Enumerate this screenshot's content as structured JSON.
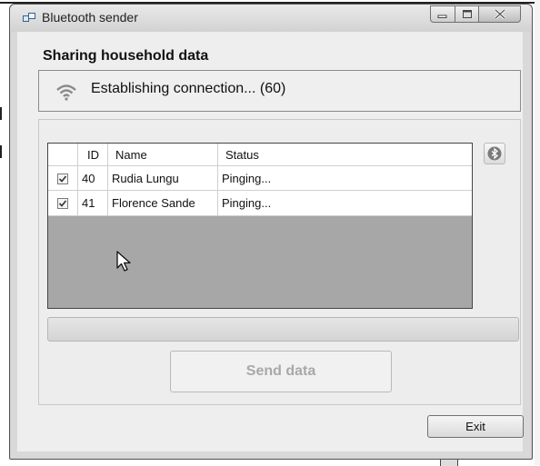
{
  "window": {
    "title": "Bluetooth sender",
    "icons": {
      "app": "window-app-icon",
      "minimize": "minimize-icon",
      "maximize": "maximize-icon",
      "close": "close-icon"
    }
  },
  "main": {
    "heading": "Sharing household data",
    "status": {
      "icon": "wifi-icon",
      "text": "Establishing connection... (60)"
    },
    "table": {
      "columns": [
        "ID",
        "Name",
        "Status"
      ],
      "rows": [
        {
          "checked": true,
          "id": "40",
          "name": "Rudia Lungu",
          "status": "Pinging..."
        },
        {
          "checked": true,
          "id": "41",
          "name": "Florence Sande",
          "status": "Pinging..."
        }
      ]
    },
    "bluetooth_button_icon": "bluetooth-icon",
    "progress": 0,
    "send_button": {
      "label": "Send data",
      "enabled": false
    }
  },
  "footer": {
    "exit_label": "Exit"
  }
}
